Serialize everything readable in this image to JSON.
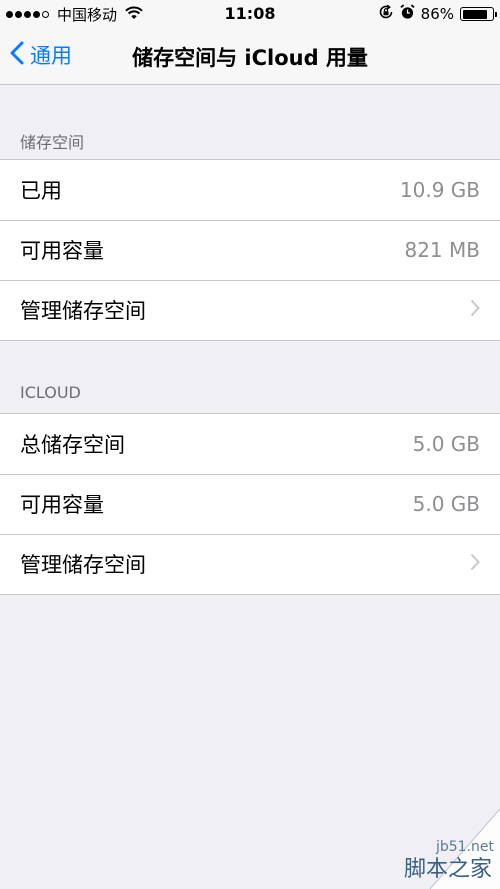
{
  "status_bar": {
    "carrier": "中国移动",
    "time": "11:08",
    "battery": "86%",
    "battery_level": 0.86
  },
  "nav": {
    "back_label": "通用",
    "title": "储存空间与 iCloud 用量"
  },
  "storage_section": {
    "header": "储存空间",
    "rows": [
      {
        "label": "已用",
        "value": "10.9 GB"
      },
      {
        "label": "可用容量",
        "value": "821 MB"
      },
      {
        "label": "管理储存空间"
      }
    ]
  },
  "icloud_section": {
    "header": "ICLOUD",
    "rows": [
      {
        "label": "总储存空间",
        "value": "5.0 GB"
      },
      {
        "label": "可用容量",
        "value": "5.0 GB"
      },
      {
        "label": "管理储存空间"
      }
    ]
  },
  "watermark": {
    "url": "jb51.net",
    "name": "脚本之家"
  },
  "colors": {
    "accent": "#0a7aff",
    "background": "#efeff4",
    "secondary_text": "#8e8e93"
  }
}
